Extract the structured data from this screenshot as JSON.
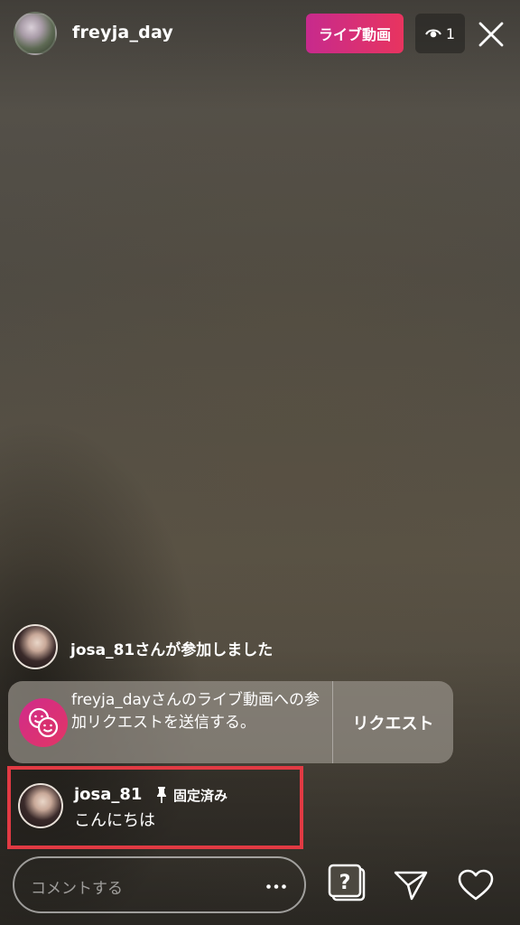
{
  "header": {
    "host_username": "freyja_day",
    "live_badge": "ライブ動画",
    "viewer_count": "1"
  },
  "notifications": {
    "join_message": "josa_81さんが参加しました"
  },
  "request_card": {
    "message": "freyja_dayさんのライブ動画への参加リクエストを送信する。",
    "button_label": "リクエスト"
  },
  "pinned_comment": {
    "username": "josa_81",
    "pinned_label": "固定済み",
    "message": "こんにちは"
  },
  "comment_bar": {
    "placeholder": "コメントする"
  },
  "colors": {
    "live_badge_start": "#c72a8d",
    "live_badge_end": "#e8345f",
    "highlight_border": "#e13a43"
  },
  "icons": {
    "viewer": "eye-icon",
    "close": "close-icon",
    "request": "faces-icon",
    "pin": "pin-icon",
    "more": "more-icon",
    "question": "question-icon",
    "send": "send-icon",
    "heart": "heart-icon"
  }
}
